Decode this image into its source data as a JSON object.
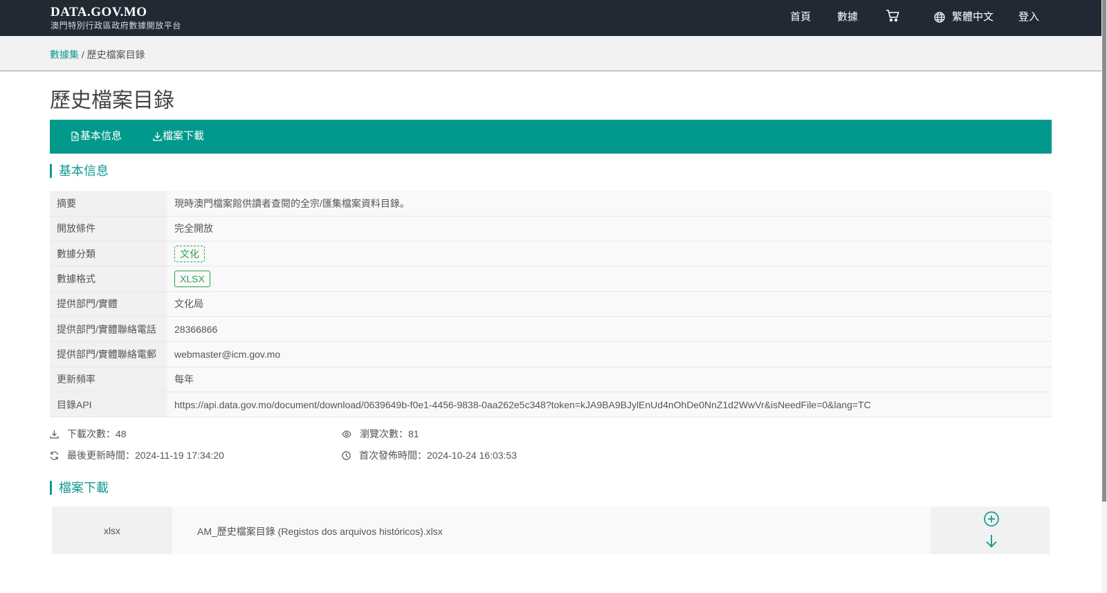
{
  "header": {
    "brand_title": "DATA.GOV.MO",
    "brand_subtitle": "澳門特別行政區政府數據開放平台",
    "nav": {
      "home": "首頁",
      "data": "數據",
      "language": "繁體中文",
      "login": "登入"
    }
  },
  "breadcrumb": {
    "root": "數據集",
    "separator": " / ",
    "current": "歷史檔案目錄"
  },
  "page": {
    "title": "歷史檔案目錄"
  },
  "tabs": [
    {
      "label": "基本信息"
    },
    {
      "label": "檔案下載"
    }
  ],
  "basic_info": {
    "heading": "基本信息",
    "rows": [
      {
        "key": "摘要",
        "value": "現時澳門檔案館供讀者查閱的全宗/匯集檔案資料目錄。"
      },
      {
        "key": "開放條件",
        "value": "完全開放"
      },
      {
        "key": "數據分類",
        "value": "文化"
      },
      {
        "key": "數據格式",
        "value": "XLSX"
      },
      {
        "key": "提供部門/實體",
        "value": "文化局"
      },
      {
        "key": "提供部門/實體聯絡電話",
        "value": "28366866"
      },
      {
        "key": "提供部門/實體聯絡電郵",
        "value": "webmaster@icm.gov.mo"
      },
      {
        "key": "更新頻率",
        "value": "每年"
      },
      {
        "key": "目錄API",
        "value": "https://api.data.gov.mo/document/download/0639649b-f0e1-4456-9838-0aa262e5c348?token=kJA9BA9BJylEnUd4nOhDe0NnZ1d2WwVr&isNeedFile=0&lang=TC"
      }
    ]
  },
  "stats": {
    "downloads": "下載次數：48",
    "views": "瀏覽次數：81",
    "last_updated": "最後更新時間：2024-11-19 17:34:20",
    "first_published": "首次發佈時間：2024-10-24 16:03:53"
  },
  "downloads_section": {
    "heading": "檔案下載",
    "files": [
      {
        "type": "xlsx",
        "name": "AM_歷史檔案目錄 (Registos dos arquivos históricos).xlsx"
      }
    ]
  },
  "colors": {
    "topbar": "#222933",
    "accent": "#01998b",
    "link": "#109a8f",
    "tag_green": "#2aa24f"
  },
  "icons": {
    "cart": "cart-icon",
    "language": "globe-icon",
    "tab_basic": "document-icon",
    "tab_download": "download-icon",
    "downloads": "download-icon",
    "views": "eye-icon",
    "updated": "refresh-icon",
    "published": "clock-icon",
    "file_add": "plus-circle-icon",
    "file_download": "arrow-down-icon"
  }
}
